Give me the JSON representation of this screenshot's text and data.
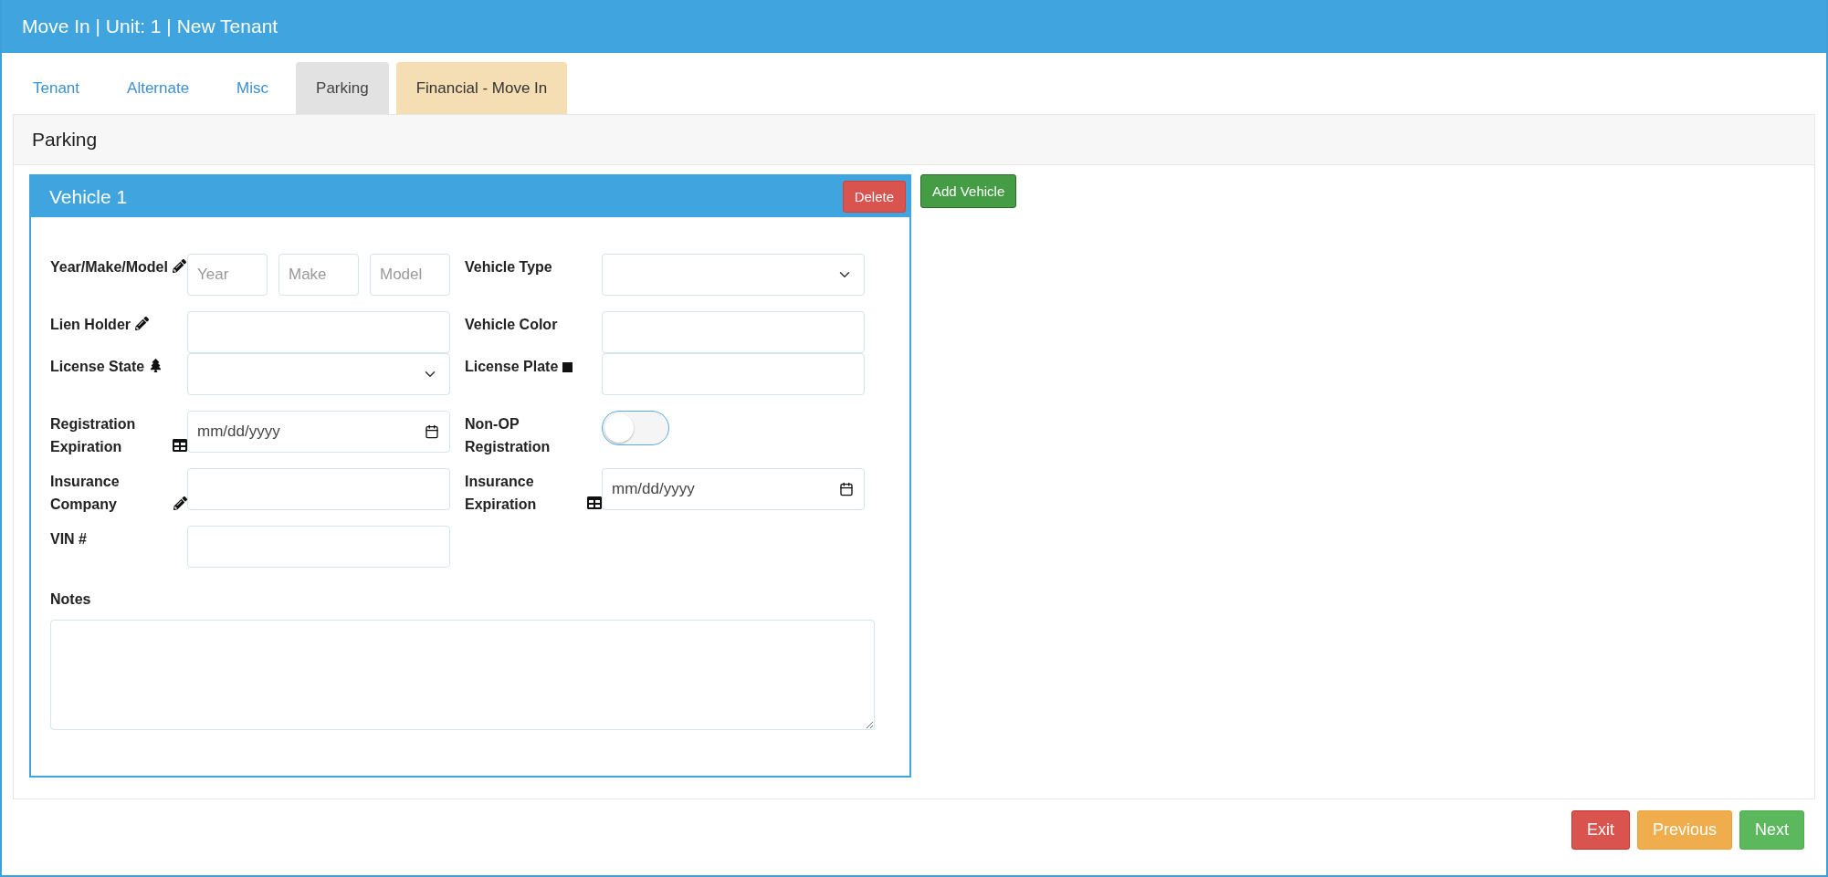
{
  "header": {
    "title": "Move In | Unit: 1 | New Tenant"
  },
  "tabs": [
    {
      "label": "Tenant",
      "selected": false,
      "kind": "link"
    },
    {
      "label": "Alternate",
      "selected": false,
      "kind": "link"
    },
    {
      "label": "Misc",
      "selected": false,
      "kind": "link"
    },
    {
      "label": "Parking",
      "selected": true,
      "kind": "link"
    },
    {
      "label": "Financial - Move In",
      "selected": false,
      "kind": "highlight"
    }
  ],
  "section": {
    "title": "Parking"
  },
  "vehicles": [
    {
      "title": "Vehicle 1",
      "delete_label": "Delete",
      "fields": [
        {
          "label": "Year/Make/Model",
          "kind": "triple",
          "placeholders": [
            "Year",
            "Make",
            "Model"
          ]
        },
        {
          "label": "Vehicle Type",
          "kind": "select"
        },
        {
          "label": "Lien Holder",
          "kind": "text"
        },
        {
          "label": "Vehicle Color",
          "kind": "text"
        },
        {
          "label": "License State",
          "kind": "select"
        },
        {
          "label": "License Plate",
          "kind": "text"
        },
        {
          "label": "Registration Expiration",
          "kind": "date",
          "placeholder": "mm/dd/yyyy"
        },
        {
          "label": "Non-OP Registration",
          "kind": "toggle",
          "on": false
        },
        {
          "label": "Insurance Company",
          "kind": "text"
        },
        {
          "label": "Insurance Expiration",
          "kind": "date",
          "placeholder": "mm/dd/yyyy"
        },
        {
          "label": "VIN #",
          "kind": "text"
        }
      ],
      "notes": {
        "label": "Notes"
      }
    }
  ],
  "add_vehicle": "Add Vehicle",
  "footer": {
    "buttons": [
      {
        "label": "Exit",
        "kind": "danger"
      },
      {
        "label": "Previous",
        "kind": "warning"
      },
      {
        "label": "Next",
        "kind": "success"
      }
    ]
  }
}
